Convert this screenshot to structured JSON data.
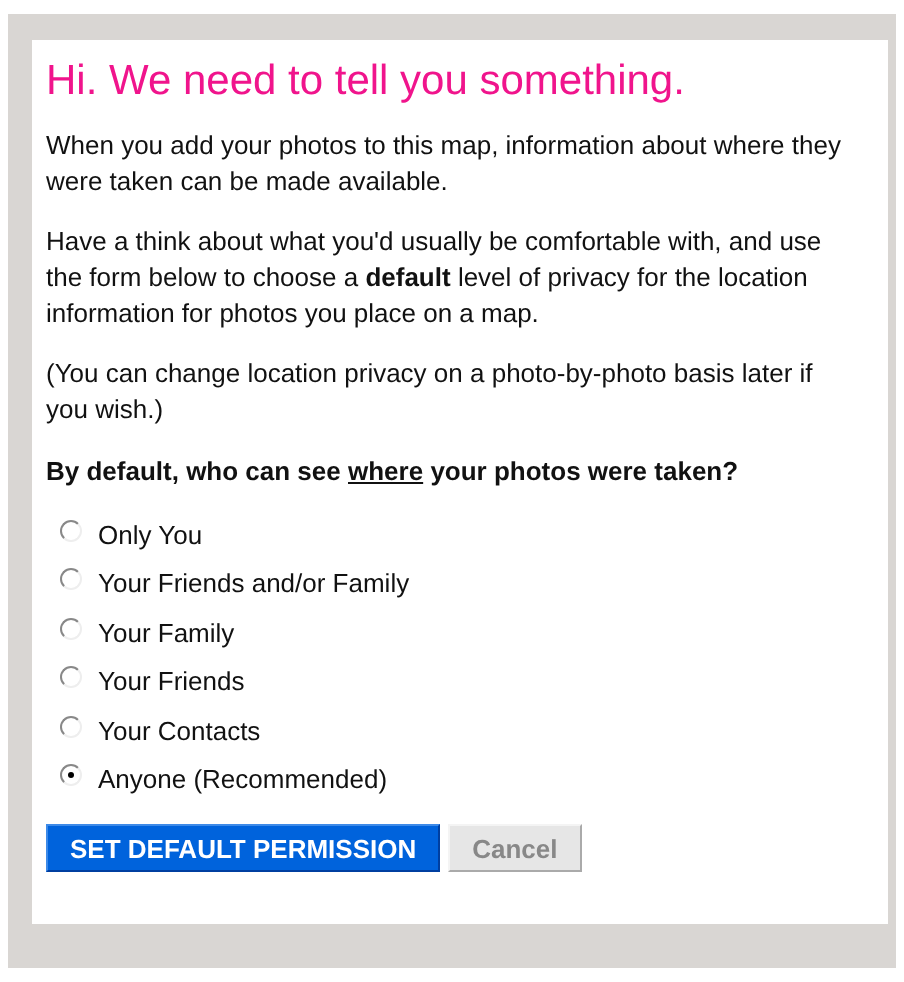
{
  "title": "Hi. We need to tell you something.",
  "paragraphs": [
    "When you add your photos to this map, information about where they were taken can be made available.",
    "Have a think about what you'd usually be comfortable with, and use the form below to choose a **default** level of privacy for the location information for photos you place on a map.",
    "(You can change location privacy on a photo-by-photo basis later if you wish.)"
  ],
  "question": [
    {
      "text": "By default, who can see ",
      "underline": false
    },
    {
      "text": "where",
      "underline": true
    },
    {
      "text": " your photos were taken?",
      "underline": false
    }
  ],
  "options": [
    {
      "label": "Only You",
      "selected": false
    },
    {
      "label": "Your Friends and/or Family",
      "selected": false
    },
    {
      "label": "Your Family",
      "selected": false
    },
    {
      "label": "Your Friends",
      "selected": false
    },
    {
      "label": "Your Contacts",
      "selected": false
    },
    {
      "label": "Anyone (Recommended)",
      "selected": true
    }
  ],
  "buttons": [
    {
      "label": "SET DEFAULT PERMISSION",
      "kind": "primary"
    },
    {
      "label": "Cancel",
      "kind": "secondary"
    }
  ]
}
